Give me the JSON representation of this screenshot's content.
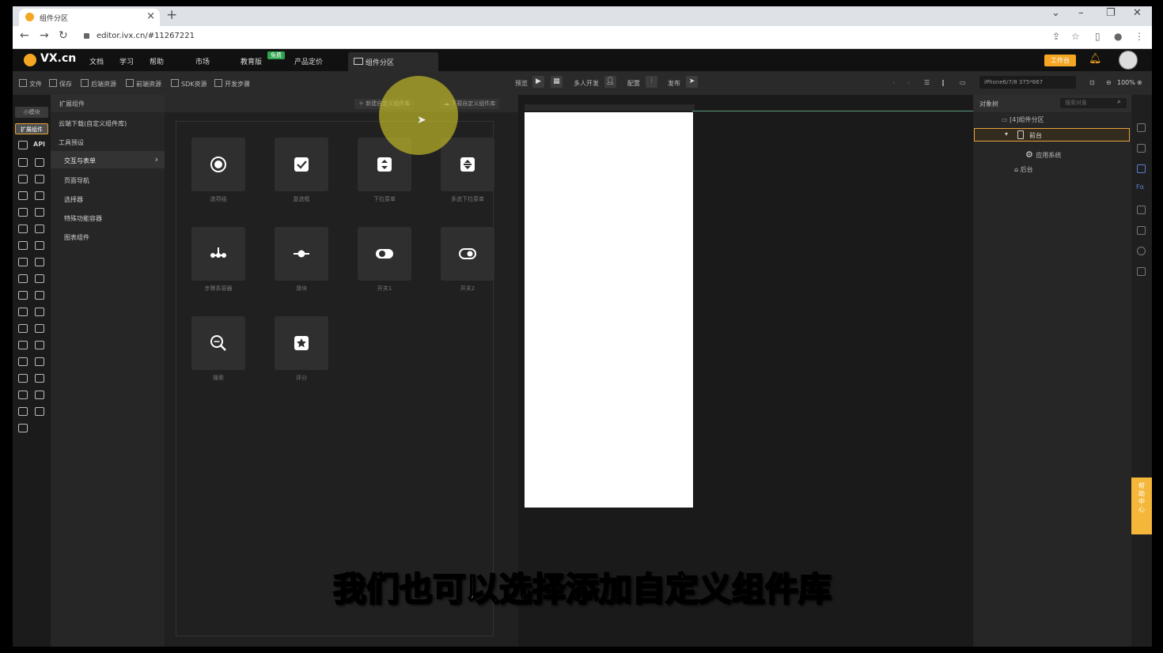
{
  "browser": {
    "tab_title": "组件分区",
    "url": "editor.ivx.cn/#11267221"
  },
  "app": {
    "logo_text": "VX.cn",
    "menus": [
      "文档",
      "学习",
      "帮助",
      "市场",
      "教育版",
      "产品定价"
    ],
    "free_badge": "免费",
    "editor_tab": "组件分区",
    "workbench_button": "工作台"
  },
  "toolbar": {
    "file": "文件",
    "save": "保存",
    "backend_resources": "后端资源",
    "frontend_resources": "前端资源",
    "sdk_resources": "SDK资源",
    "dev_steps": "开发步骤",
    "preview": "预览",
    "multi_dev": "多人开发",
    "config": "配置",
    "publish": "发布",
    "device": "iPhone6/7/8 375*667",
    "zoom": "100%"
  },
  "rail": {
    "tab_small_modules": "小模块",
    "tab_extension": "扩展组件",
    "api_label": "API"
  },
  "category_panel": {
    "title": "扩展组件",
    "items": [
      "云端下载(自定义组件库)",
      "工具预设",
      "交互与表单",
      "页面导航",
      "选择器",
      "特殊功能容器",
      "图表组件"
    ],
    "selected": "交互与表单"
  },
  "component_panel": {
    "new_library_button": "新建自定义组件库",
    "download_library_button": "下载自定义组件库",
    "components": [
      "选项组",
      "复选框",
      "下拉菜单",
      "多选下拉菜单",
      "步骤条容器",
      "滑块",
      "开关1",
      "开关2",
      "搜索",
      "评分"
    ]
  },
  "object_panel": {
    "title": "对象树",
    "search_placeholder": "搜索对象",
    "root": "[4]组件分区",
    "frontend": "前台",
    "app_system": "应用系统",
    "backend": "后台"
  },
  "help_button": "帮助中心",
  "subtitle": "我们也可以选择添加自定义组件库"
}
